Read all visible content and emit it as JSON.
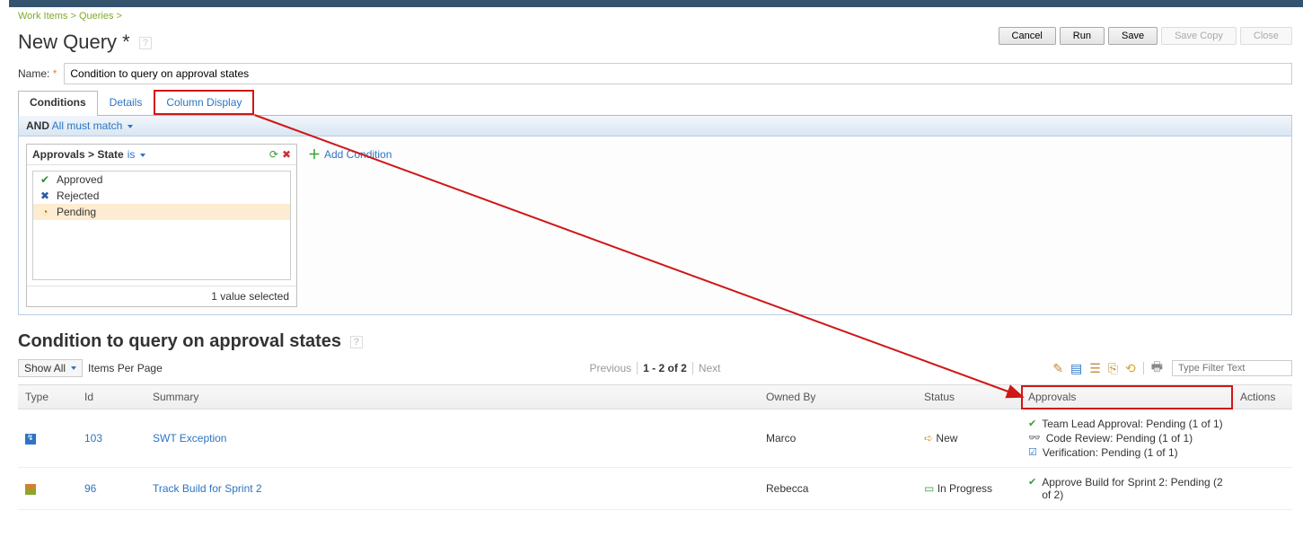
{
  "breadcrumb": {
    "crumb1": "Work Items",
    "crumb2": "Queries"
  },
  "page_title": "New Query *",
  "buttons": {
    "cancel": "Cancel",
    "run": "Run",
    "save": "Save",
    "save_copy": "Save Copy",
    "close": "Close"
  },
  "name_label": "Name:",
  "name_value": "Condition to query on approval states",
  "tabs": {
    "conditions": "Conditions",
    "details": "Details",
    "column_display": "Column Display"
  },
  "cond_bar": {
    "and": "AND",
    "mode": "All must match"
  },
  "cond_card": {
    "title": "Approvals > State",
    "operator": "is",
    "options": {
      "approved": "Approved",
      "rejected": "Rejected",
      "pending": "Pending"
    },
    "footer": "1 value selected"
  },
  "add_condition": "Add Condition",
  "results_title": "Condition to query on approval states",
  "toolbar": {
    "show_all": "Show All",
    "items_per_page": "Items Per Page",
    "previous": "Previous",
    "range": "1 - 2 of 2",
    "next": "Next",
    "filter_placeholder": "Type Filter Text"
  },
  "columns": {
    "type": "Type",
    "id": "Id",
    "summary": "Summary",
    "owned_by": "Owned By",
    "status": "Status",
    "approvals": "Approvals",
    "actions": "Actions"
  },
  "rows": [
    {
      "id": "103",
      "summary": "SWT Exception",
      "owned_by": "Marco",
      "status": "New",
      "approvals": [
        "Team Lead Approval: Pending (1 of 1)",
        "Code Review: Pending (1 of 1)",
        "Verification: Pending (1 of 1)"
      ]
    },
    {
      "id": "96",
      "summary": "Track Build for Sprint 2",
      "owned_by": "Rebecca",
      "status": "In Progress",
      "approvals": [
        "Approve Build for Sprint 2: Pending (2 of 2)"
      ]
    }
  ]
}
